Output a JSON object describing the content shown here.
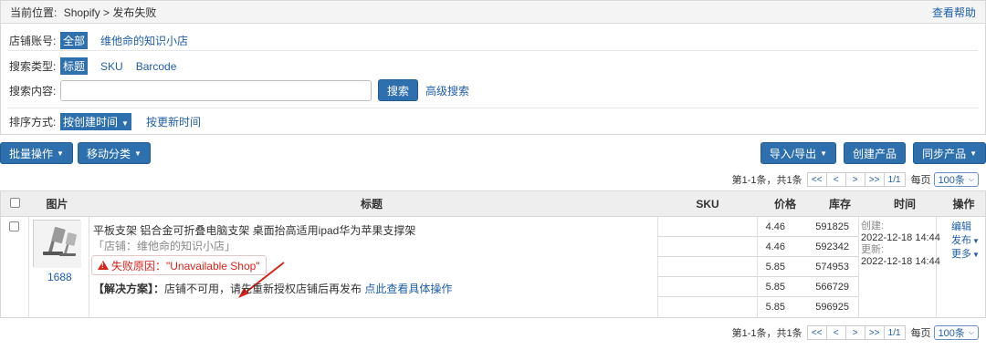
{
  "breadcrumb": {
    "prefix": "当前位置:",
    "path": "Shopify > 发布失败",
    "help": "查看帮助"
  },
  "filters": {
    "shop": {
      "label": "店铺账号:",
      "options": [
        "全部",
        "维他命的知识小店"
      ]
    },
    "search_type": {
      "label": "搜索类型:",
      "options": [
        "标题",
        "SKU",
        "Barcode"
      ]
    },
    "search": {
      "label": "搜索内容:",
      "value": "",
      "placeholder": "",
      "button": "搜索",
      "advanced": "高级搜索"
    },
    "sort": {
      "label": "排序方式:",
      "selected": "按创建时间",
      "alt": "按更新时间"
    }
  },
  "toolbar": {
    "batch": "批量操作",
    "move": "移动分类",
    "import_export": "导入/导出",
    "create": "创建产品",
    "sync": "同步产品"
  },
  "pagination": {
    "info": "第1-1条，共1条",
    "first": "<<",
    "prev": "<",
    "next": ">",
    "last": ">>",
    "page": "1/1",
    "per_page_label": "每页",
    "per_page": "100条"
  },
  "table": {
    "headers": {
      "image": "图片",
      "title": "标题",
      "sku": "SKU",
      "price": "价格",
      "stock": "库存",
      "time": "时间",
      "action": "操作"
    },
    "row": {
      "source": "1688",
      "title": "平板支架 铝合金可折叠电脑支架 桌面抬高适用ipad华为苹果支撑架",
      "shop": "「店铺：维他命的知识小店」",
      "fail_reason": "失败原因：\"Unavailable Shop\"",
      "solution_label": "【解决方案】：",
      "solution_text": "店铺不可用，请先重新授权店铺后再发布",
      "solution_link": "点此查看具体操作",
      "variants": [
        {
          "price": "4.46",
          "stock": "591825"
        },
        {
          "price": "4.46",
          "stock": "592342"
        },
        {
          "price": "5.85",
          "stock": "574953"
        },
        {
          "price": "5.85",
          "stock": "566729"
        },
        {
          "price": "5.85",
          "stock": "596925"
        }
      ],
      "created_label": "创建:",
      "created": "2022-12-18 14:44",
      "updated_label": "更新:",
      "updated": "2022-12-18 14:44",
      "actions": {
        "edit": "编辑",
        "publish": "发布",
        "more": "更多"
      }
    }
  },
  "colors": {
    "primary": "#2e6fad",
    "link": "#1f5fa8",
    "error": "#d9241c"
  }
}
